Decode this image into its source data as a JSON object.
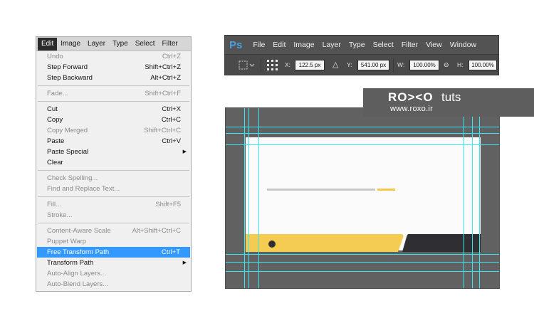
{
  "edit_menu": {
    "menubar": [
      "Edit",
      "Image",
      "Layer",
      "Type",
      "Select",
      "Filter"
    ],
    "active_menu": "Edit",
    "groups": [
      [
        {
          "label": "Undo",
          "shortcut": "Ctrl+Z",
          "enabled": false
        },
        {
          "label": "Step Forward",
          "shortcut": "Shift+Ctrl+Z",
          "enabled": true
        },
        {
          "label": "Step Backward",
          "shortcut": "Alt+Ctrl+Z",
          "enabled": true
        }
      ],
      [
        {
          "label": "Fade...",
          "shortcut": "Shift+Ctrl+F",
          "enabled": false
        }
      ],
      [
        {
          "label": "Cut",
          "shortcut": "Ctrl+X",
          "enabled": true
        },
        {
          "label": "Copy",
          "shortcut": "Ctrl+C",
          "enabled": true
        },
        {
          "label": "Copy Merged",
          "shortcut": "Shift+Ctrl+C",
          "enabled": false
        },
        {
          "label": "Paste",
          "shortcut": "Ctrl+V",
          "enabled": true
        },
        {
          "label": "Paste Special",
          "shortcut": "",
          "enabled": true,
          "submenu": true
        },
        {
          "label": "Clear",
          "shortcut": "",
          "enabled": true
        }
      ],
      [
        {
          "label": "Check Spelling...",
          "shortcut": "",
          "enabled": false
        },
        {
          "label": "Find and Replace Text...",
          "shortcut": "",
          "enabled": false
        }
      ],
      [
        {
          "label": "Fill...",
          "shortcut": "Shift+F5",
          "enabled": false
        },
        {
          "label": "Stroke...",
          "shortcut": "",
          "enabled": false
        }
      ],
      [
        {
          "label": "Content-Aware Scale",
          "shortcut": "Alt+Shift+Ctrl+C",
          "enabled": false
        },
        {
          "label": "Puppet Warp",
          "shortcut": "",
          "enabled": false
        },
        {
          "label": "Free Transform Path",
          "shortcut": "Ctrl+T",
          "enabled": true,
          "highlighted": true
        },
        {
          "label": "Transform Path",
          "shortcut": "",
          "enabled": true,
          "submenu": true
        },
        {
          "label": "Auto-Align Layers...",
          "shortcut": "",
          "enabled": false
        },
        {
          "label": "Auto-Blend Layers...",
          "shortcut": "",
          "enabled": false
        }
      ]
    ]
  },
  "photoshop": {
    "logo": "Ps",
    "menus": [
      "File",
      "Edit",
      "Image",
      "Layer",
      "Type",
      "Select",
      "Filter",
      "View",
      "Window"
    ],
    "options": {
      "x_label": "X:",
      "x_value": "122.5 px",
      "delta_symbol": "△",
      "y_label": "Y:",
      "y_value": "541.00 px",
      "w_label": "W:",
      "w_value": "100.00%",
      "link_symbol": "⊖",
      "h_label": "H:",
      "h_value": "100.00%"
    }
  },
  "watermark": {
    "logo": "RO><O",
    "tuts": "tuts",
    "url": "www.roxo.ir"
  },
  "colors": {
    "accent_yellow": "#f5cc52",
    "dark_block": "#2f2f33",
    "guide_cyan": "#38e8f0",
    "menu_highlight": "#3399ff",
    "ps_blue": "#48a0e0"
  }
}
